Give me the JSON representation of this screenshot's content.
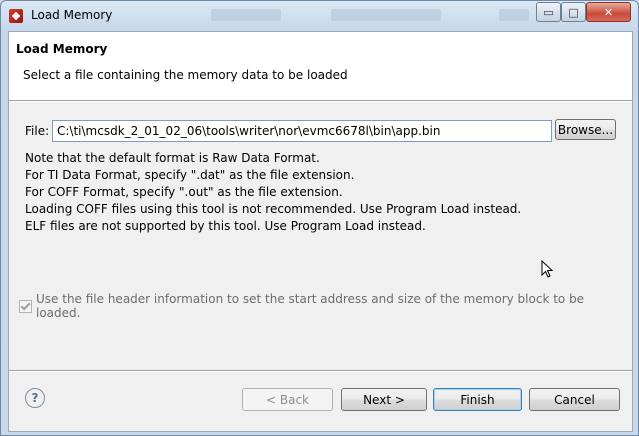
{
  "window": {
    "title": "Load Memory",
    "controls": {
      "minimize": "▭",
      "maximize": "□",
      "close": "✕"
    }
  },
  "banner": {
    "title": "Load Memory",
    "subtitle": "Select a file containing the memory data to be loaded"
  },
  "file": {
    "label": "File:",
    "value": "C:\\ti\\mcsdk_2_01_02_06\\tools\\writer\\nor\\evmc6678l\\bin\\app.bin",
    "browse_label": "Browse..."
  },
  "notes": [
    "Note that the default format is Raw Data Format.",
    "For TI Data Format, specify \".dat\" as the file extension.",
    "For COFF Format, specify \".out\" as the file extension.",
    "Loading COFF files using this tool is not recommended. Use Program Load instead.",
    "ELF files are not supported by this tool. Use Program Load instead."
  ],
  "options": {
    "use_header_label": "Use the file header information to set the start address and size of the memory block to be loaded.",
    "use_header_checked": true,
    "use_header_enabled": false
  },
  "footer": {
    "help_glyph": "?",
    "back_label": "< Back",
    "next_label": "Next >",
    "finish_label": "Finish",
    "cancel_label": "Cancel"
  }
}
